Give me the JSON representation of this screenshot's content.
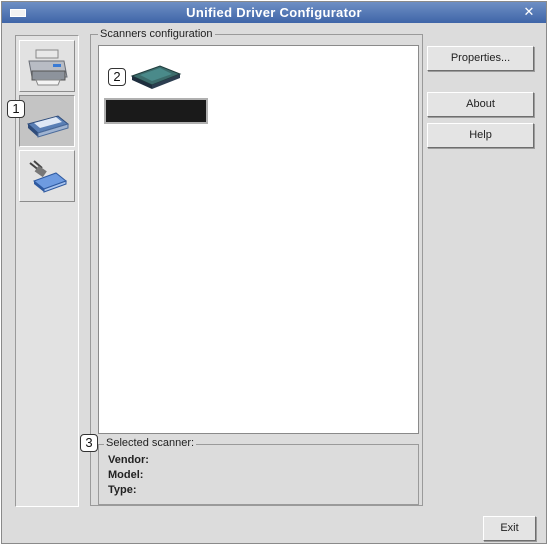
{
  "window": {
    "title": "Unified Driver Configurator"
  },
  "sidebar": {
    "items": [
      {
        "name": "printers",
        "icon": "printer-icon"
      },
      {
        "name": "scanners",
        "icon": "scanner-icon",
        "active": true,
        "callout": "1"
      },
      {
        "name": "ports",
        "icon": "port-icon"
      }
    ]
  },
  "scanners": {
    "group_label": "Scanners configuration",
    "item_callout": "2",
    "selected_label": "Selected scanner:",
    "selected_callout": "3",
    "vendor_label": "Vendor:",
    "model_label": "Model:",
    "type_label": "Type:"
  },
  "buttons": {
    "properties": "Properties...",
    "about": "About",
    "help": "Help",
    "exit": "Exit"
  },
  "colors": {
    "titlebar": "#4a6fb0",
    "window_bg": "#dcdcdc",
    "list_bg": "#ffffff"
  }
}
